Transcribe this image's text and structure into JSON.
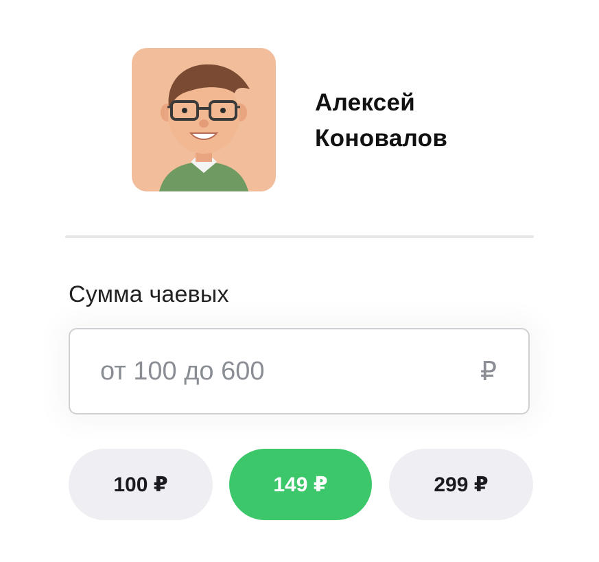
{
  "recipient": {
    "name_first": "Алексей",
    "name_last": "Коновалов",
    "avatar_icon": "user-avatar-3d-glasses",
    "avatar_bg": "#f1bd9b"
  },
  "tip": {
    "label": "Сумма чаевых",
    "input_value": "",
    "input_placeholder": "от 100 до 600",
    "currency": "₽"
  },
  "presets": [
    {
      "label": "100 ₽",
      "selected": false
    },
    {
      "label": "149 ₽",
      "selected": true
    },
    {
      "label": "299 ₽",
      "selected": false
    }
  ],
  "colors": {
    "accent": "#3cc76b",
    "chip_bg": "#efeff3",
    "divider": "#e6e6e6",
    "placeholder": "#8a8e94"
  }
}
